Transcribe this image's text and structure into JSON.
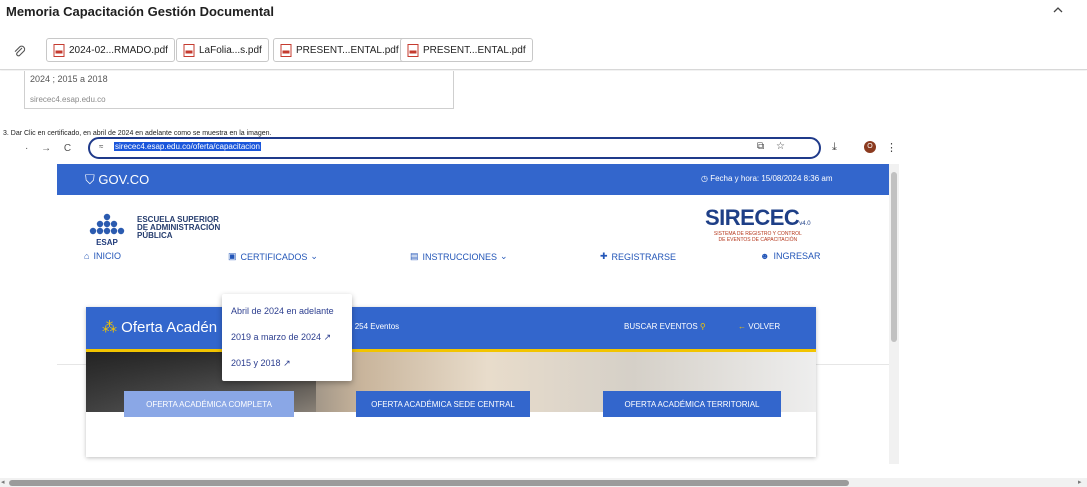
{
  "header": {
    "title": "Memoria Capacitación Gestión Documental",
    "collapse_icon": "chevron-up-icon"
  },
  "attachments": {
    "icon": "paperclip-icon",
    "files": [
      {
        "name": "2024-02...RMADO.pdf"
      },
      {
        "name": "LaFolia...s.pdf"
      },
      {
        "name": "PRESENT...ENTAL.pdf"
      },
      {
        "name": "PRESENT...ENTAL.pdf"
      }
    ]
  },
  "document": {
    "snippet_line1": "2024 ; 2015 a 2018",
    "snippet_line2": "sirecec4.esap.edu.co",
    "step_text": "3. Dar Clic en certificado, en abril de 2024 en adelante como se muestra en la imagen."
  },
  "browser": {
    "nav_back": "·",
    "nav_forward": "→",
    "nav_reload": "C",
    "url": "sirecec4.esap.edu.co/oferta/capacitacion",
    "profile_initial": "O"
  },
  "site": {
    "gov_logo": "GOV.CO",
    "date_text": "Fecha y hora: 15/08/2024 8:36 am",
    "esap_name": [
      "ESCUELA SUPERIOR",
      "DE ADMINISTRACIÓN",
      "PÚBLICA"
    ],
    "esap_mark": "ESAP",
    "sirecec_title": "SIRECEC",
    "sirecec_version": "v4.0",
    "sirecec_sub": [
      "SISTEMA DE REGISTRO Y CONTROL",
      "DE EVENTOS DE CAPACITACIÓN"
    ],
    "menu": {
      "inicio": "INICIO",
      "certificados": "CERTIFICADOS",
      "instrucciones": "INSTRUCCIONES",
      "registrarse": "REGISTRARSE",
      "ingresar": "INGRESAR"
    },
    "dropdown": [
      "Abril de 2024 en adelante",
      "2019 a marzo de 2024",
      "2015 y 2018"
    ],
    "banner": {
      "title": "Oferta Acadén",
      "count": "254 Eventos",
      "search": "BUSCAR EVENTOS",
      "back": "VOLVER"
    },
    "buttons": [
      "OFERTA ACADÉMICA COMPLETA",
      "OFERTA ACADÉMICA SEDE CENTRAL",
      "OFERTA ACADÉMICA TERRITORIAL"
    ]
  },
  "colors": {
    "gov_blue": "#3366cc",
    "accent_yellow": "#f2c400",
    "disabled_button": "#8aa7e6",
    "button_blue": "#3366cc"
  }
}
